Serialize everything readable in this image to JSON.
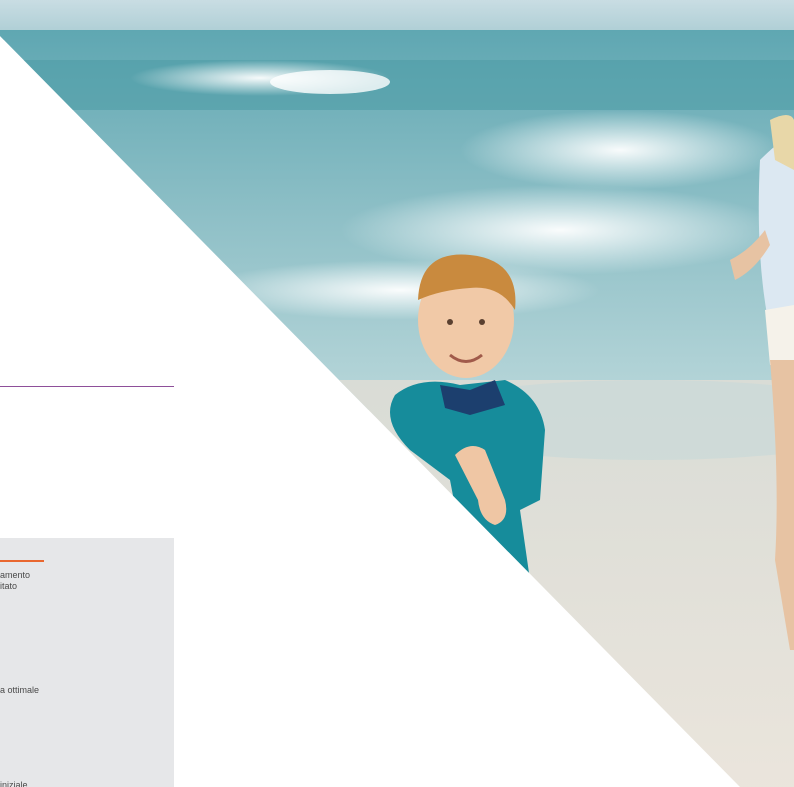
{
  "photo": {
    "subject": "beach-photo-child-and-adult",
    "colors": {
      "sea": "#7fb3bb",
      "sand": "#e9e3da",
      "shirt": "#168c9b",
      "hair": "#c98a3e"
    }
  },
  "sidebar": {
    "accent_rule_color": "#8e4f9a",
    "box_accent_color": "#e9672f",
    "lines": [
      "amento",
      "itato",
      "a ottimale",
      "iniziale"
    ]
  }
}
